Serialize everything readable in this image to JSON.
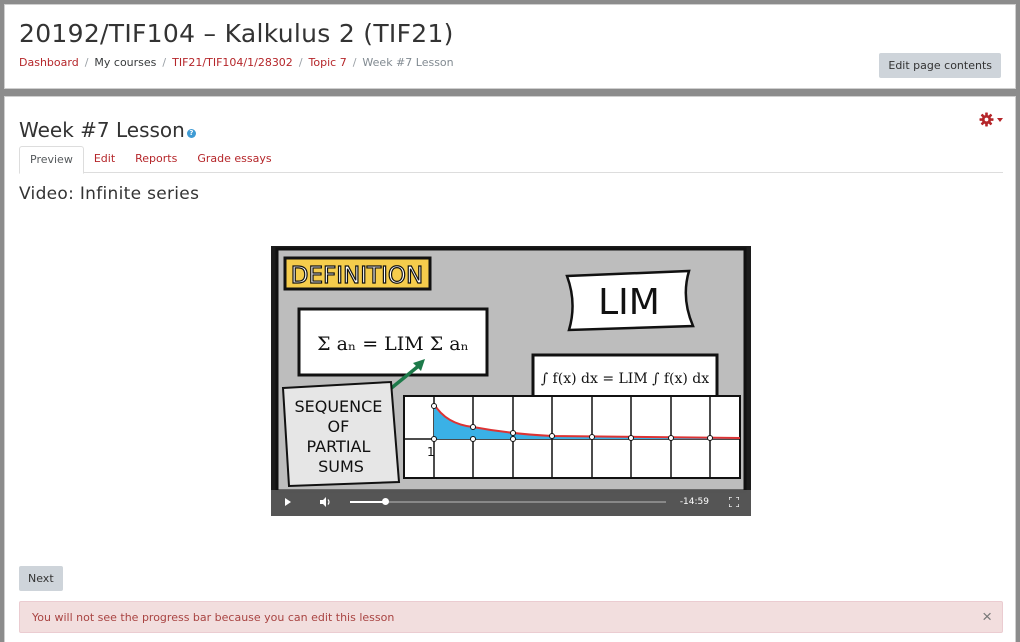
{
  "header": {
    "course_title": "20192/TIF104 – Kalkulus 2 (TIF21)",
    "breadcrumb": [
      {
        "label": "Dashboard"
      },
      {
        "label": "My courses"
      },
      {
        "label": "TIF21/TIF104/1/28302"
      },
      {
        "label": "Topic 7"
      },
      {
        "label": "Week #7 Lesson"
      }
    ],
    "edit_button": "Edit page contents"
  },
  "lesson": {
    "title": "Week #7 Lesson",
    "help_icon": "?",
    "tabs": [
      {
        "label": "Preview",
        "active": true
      },
      {
        "label": "Edit"
      },
      {
        "label": "Reports"
      },
      {
        "label": "Grade essays"
      }
    ],
    "page_title": "Video: Infinite series",
    "video": {
      "frame_text": {
        "definition": "DEFINITION",
        "lim": "LIM",
        "series_formula": "Σ aₙ = LIM Σ aₙ",
        "integral_formula": "∫ f(x) dx = LIM ∫ f(x) dx",
        "sequence_label": [
          "SEQUENCE",
          "OF",
          "PARTIAL",
          "SUMS"
        ],
        "graph_tick": "1"
      },
      "time_remaining": "-14:59",
      "progress": 0.11
    },
    "next_button": "Next",
    "alert": {
      "message": "You will not see the progress bar because you can edit this lesson",
      "close_symbol": "×"
    }
  },
  "colors": {
    "link": "#b5262a",
    "alert_bg": "#f2dede",
    "alert_text": "#a94442",
    "button_bg": "#ced4da"
  }
}
